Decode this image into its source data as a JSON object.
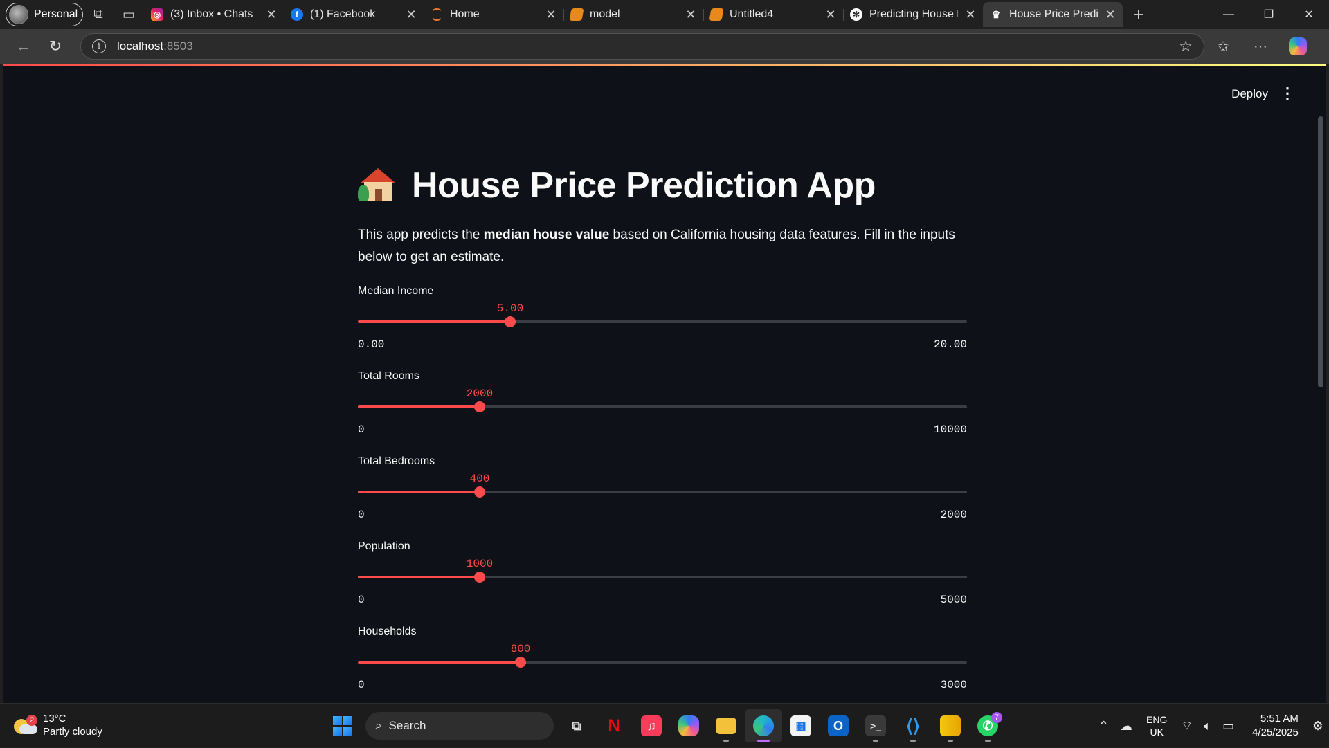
{
  "browser": {
    "profile_label": "Personal",
    "tabs": [
      {
        "title": "(3) Inbox • Chats",
        "icon": "instagram-icon"
      },
      {
        "title": "(1) Facebook",
        "icon": "facebook-icon"
      },
      {
        "title": "Home",
        "icon": "jupyter-icon"
      },
      {
        "title": "model",
        "icon": "notebook-icon"
      },
      {
        "title": "Untitled4",
        "icon": "notebook-icon"
      },
      {
        "title": "Predicting House P",
        "icon": "chatgpt-icon"
      },
      {
        "title": "House Price Predic",
        "icon": "streamlit-icon",
        "active": true
      }
    ],
    "url_host": "localhost",
    "url_port": ":8503"
  },
  "app": {
    "deploy_label": "Deploy",
    "title": "House Price Prediction App",
    "intro_before": "This app predicts the ",
    "intro_bold": "median house value",
    "intro_after": " based on California housing data features. Fill in the inputs below to get an estimate.",
    "accent_color": "#ff4b4b",
    "sliders": [
      {
        "label": "Median Income",
        "value": "5.00",
        "min": "0.00",
        "max": "20.00",
        "fraction": 0.25
      },
      {
        "label": "Total Rooms",
        "value": "2000",
        "min": "0",
        "max": "10000",
        "fraction": 0.2
      },
      {
        "label": "Total Bedrooms",
        "value": "400",
        "min": "0",
        "max": "2000",
        "fraction": 0.2
      },
      {
        "label": "Population",
        "value": "1000",
        "min": "0",
        "max": "5000",
        "fraction": 0.2
      },
      {
        "label": "Households",
        "value": "800",
        "min": "0",
        "max": "3000",
        "fraction": 0.2667
      }
    ]
  },
  "taskbar": {
    "weather_temp": "13°C",
    "weather_desc": "Partly cloudy",
    "weather_badge": "2",
    "search_label": "Search",
    "whatsapp_badge": "7",
    "lang_line1": "ENG",
    "lang_line2": "UK",
    "time": "5:51 AM",
    "date": "4/25/2025"
  }
}
